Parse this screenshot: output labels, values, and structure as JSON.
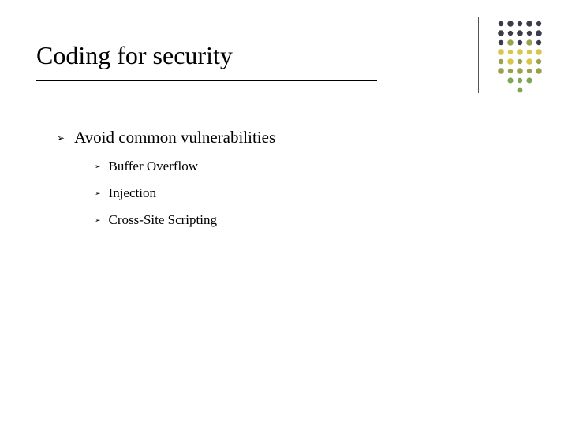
{
  "slide": {
    "title": "Coding for security",
    "bullet_l1": "Avoid common vulnerabilities",
    "sub_items": [
      "Buffer Overflow",
      "Injection",
      "Cross-Site Scripting"
    ]
  },
  "deco_colors": {
    "dark": "#3b3b49",
    "yellow": "#d7c64a",
    "olive": "#9aa04b",
    "green": "#7da656"
  }
}
